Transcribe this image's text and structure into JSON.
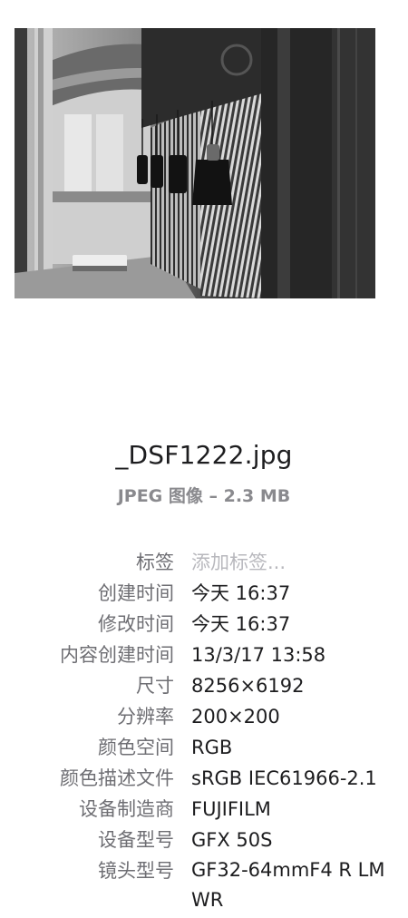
{
  "file": {
    "name": "_DSF1222.jpg",
    "kind": "JPEG 图像 – 2.3 MB"
  },
  "info": {
    "rows": [
      {
        "label": "标签",
        "value": "添加标签..."
      },
      {
        "label": "创建时间",
        "value": "今天 16:37"
      },
      {
        "label": "修改时间",
        "value": "今天 16:37"
      },
      {
        "label": "内容创建时间",
        "value": "13/3/17 13:58"
      },
      {
        "label": "尺寸",
        "value": "8256×6192"
      },
      {
        "label": "分辨率",
        "value": "200×200"
      },
      {
        "label": "颜色空间",
        "value": "RGB"
      },
      {
        "label": "颜色描述文件",
        "value": "sRGB IEC61966-2.1"
      },
      {
        "label": "设备制造商",
        "value": "FUJIFILM"
      },
      {
        "label": "设备型号",
        "value": "GFX 50S"
      },
      {
        "label": "镜头型号",
        "value": "GF32-64mmF4 R LM WR"
      }
    ]
  }
}
